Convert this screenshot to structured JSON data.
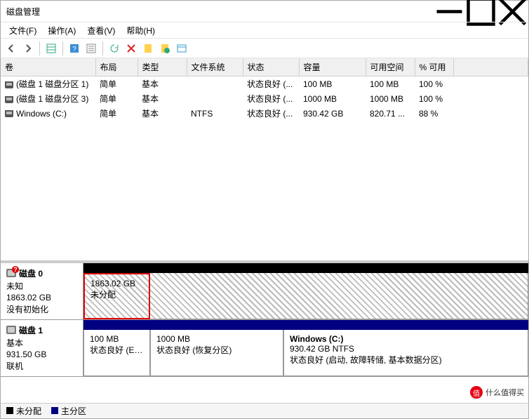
{
  "window": {
    "title": "磁盘管理"
  },
  "menu": {
    "file": "文件(F)",
    "action": "操作(A)",
    "view": "查看(V)",
    "help": "帮助(H)"
  },
  "columns": {
    "vol": "卷",
    "layout": "布局",
    "type": "类型",
    "fs": "文件系统",
    "status": "状态",
    "capacity": "容量",
    "free": "可用空间",
    "pct": "% 可用"
  },
  "volumes": [
    {
      "name": "(磁盘 1 磁盘分区 1)",
      "layout": "简单",
      "type": "基本",
      "fs": "",
      "status": "状态良好 (...",
      "cap": "100 MB",
      "free": "100 MB",
      "pct": "100 %"
    },
    {
      "name": "(磁盘 1 磁盘分区 3)",
      "layout": "简单",
      "type": "基本",
      "fs": "",
      "status": "状态良好 (...",
      "cap": "1000 MB",
      "free": "1000 MB",
      "pct": "100 %"
    },
    {
      "name": "Windows (C:)",
      "layout": "简单",
      "type": "基本",
      "fs": "NTFS",
      "status": "状态良好 (...",
      "cap": "930.42 GB",
      "free": "820.71 ...",
      "pct": "88 %"
    }
  ],
  "disk0": {
    "name": "磁盘 0",
    "type": "未知",
    "size": "1863.02 GB",
    "state": "没有初始化",
    "part": {
      "size": "1863.02 GB",
      "label": "未分配"
    }
  },
  "disk1": {
    "name": "磁盘 1",
    "type": "基本",
    "size": "931.50 GB",
    "state": "联机",
    "p1": {
      "size": "100 MB",
      "status": "状态良好 (EFI 系"
    },
    "p2": {
      "size": "1000 MB",
      "status": "状态良好 (恢复分区)"
    },
    "p3": {
      "title": "Windows  (C:)",
      "sub": "930.42 GB NTFS",
      "status": "状态良好 (启动, 故障转储, 基本数据分区)"
    }
  },
  "legend": {
    "unalloc": "未分配",
    "primary": "主分区"
  },
  "watermark": "什么值得买"
}
